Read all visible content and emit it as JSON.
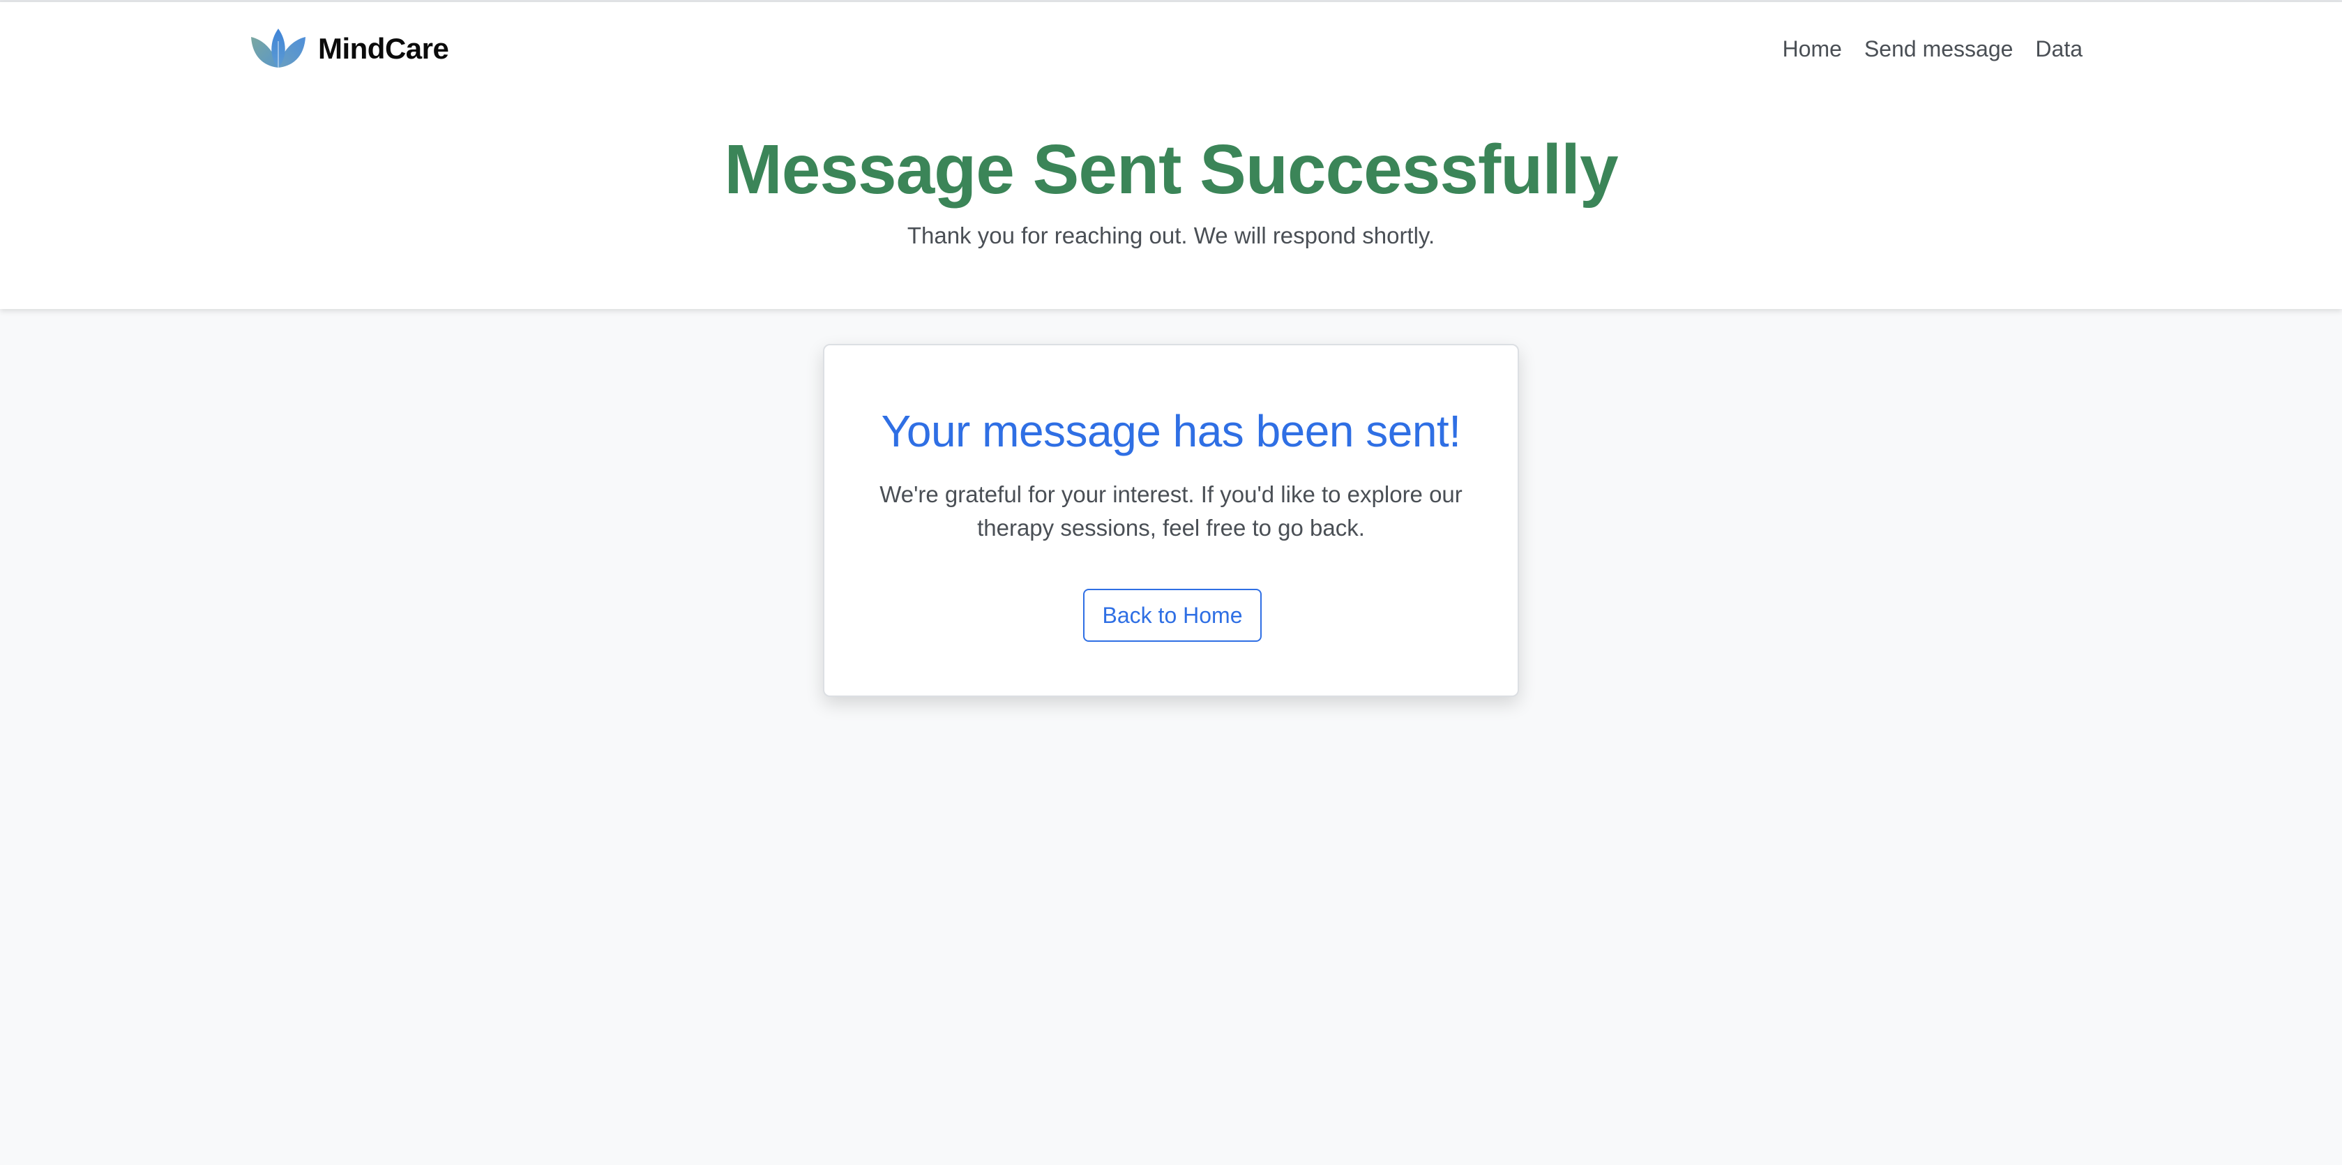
{
  "brand": {
    "name": "MindCare",
    "logo_icon": "lotus-icon",
    "logo_colors": [
      "#4f8fd9",
      "#7aa7a0"
    ]
  },
  "nav": {
    "items": [
      {
        "label": "Home"
      },
      {
        "label": "Send message"
      },
      {
        "label": "Data"
      }
    ]
  },
  "hero": {
    "title": "Message Sent Successfully",
    "subtitle": "Thank you for reaching out. We will respond shortly."
  },
  "card": {
    "title": "Your message has been sent!",
    "text": "We're grateful for your interest. If you'd like to explore our therapy sessions, feel free to go back.",
    "button_label": "Back to Home"
  },
  "colors": {
    "title_green": "#3b8558",
    "accent_blue": "#2f6fe4",
    "page_background": "#f8f9fa",
    "muted_text": "#4a4f55"
  }
}
